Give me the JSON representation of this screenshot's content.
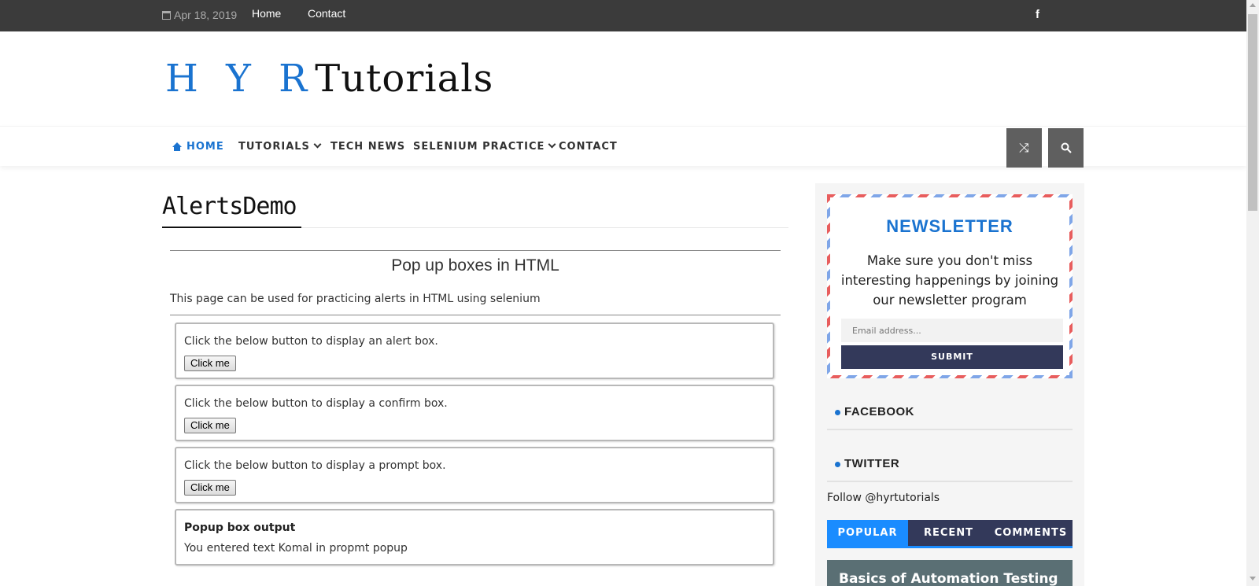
{
  "topbar": {
    "date": "Apr 18, 2019",
    "links": [
      "Home",
      "Contact"
    ],
    "social_icon": "f"
  },
  "logo": {
    "part1": "H Y R",
    "part2": "Tutorials"
  },
  "nav": {
    "items": [
      {
        "label": "HOME",
        "active": true
      },
      {
        "label": "TUTORIALS",
        "dropdown": true
      },
      {
        "label": "TECH NEWS"
      },
      {
        "label": "SELENIUM PRACTICE",
        "dropdown": true
      },
      {
        "label": "CONTACT"
      }
    ],
    "random_icon": "⤨",
    "search_icon": "🔍"
  },
  "main": {
    "title": "AlertsDemo",
    "heading": "Pop up boxes in HTML",
    "intro": "This page can be used for practicing alerts in HTML using selenium",
    "boxes": [
      {
        "text": "Click the below button to display an alert box.",
        "button": "Click me"
      },
      {
        "text": "Click the below button to display a confirm box.",
        "button": "Click me"
      },
      {
        "text": "Click the below button to display a prompt box.",
        "button": "Click me"
      }
    ],
    "output": {
      "label": "Popup box output",
      "text": "You entered text Komal in propmt popup"
    }
  },
  "sidebar": {
    "newsletter": {
      "title": "NEWSLETTER",
      "text": "Make sure you don't miss interesting happenings by joining our newsletter program",
      "placeholder": "Email address...",
      "submit": "SUBMIT"
    },
    "widgets": [
      "FACEBOOK",
      "TWITTER"
    ],
    "follow": "Follow @hyrtutorials",
    "tabs": [
      "POPULAR",
      "RECENT",
      "COMMENTS"
    ],
    "post_title": "Basics of Automation Testing"
  },
  "colors": {
    "accent": "#1a73d0",
    "topbar": "#3b3b3b",
    "dark_button": "#33395a"
  }
}
